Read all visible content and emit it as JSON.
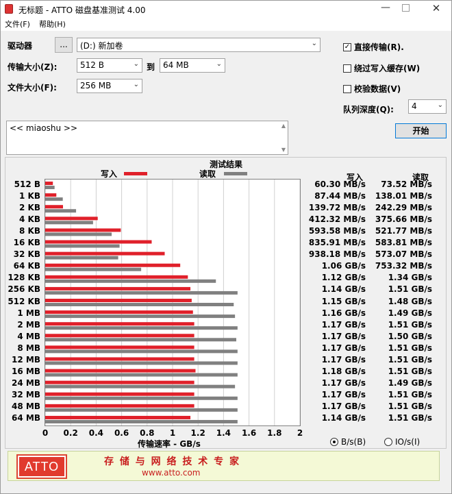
{
  "window": {
    "title": "无标题 - ATTO 磁盘基准测试 4.00",
    "controls": [
      "minimize-icon",
      "maximize-icon",
      "close-icon"
    ]
  },
  "menu": [
    {
      "label": "文件(F)"
    },
    {
      "label": "帮助(H)"
    }
  ],
  "settings": {
    "drive_label": "驱动器",
    "browse_label": "...",
    "drive_value": "(D:) 新加卷",
    "transfer_label": "传输大小(Z):",
    "transfer_from": "512 B",
    "to_label": "到",
    "transfer_to": "64 MB",
    "file_size_label": "文件大小(F):",
    "file_size": "256 MB",
    "direct_io_label": "直接传输(R).",
    "direct_io_checked": true,
    "bypass_cache_label": "绕过写入缓存(W)",
    "bypass_cache_checked": false,
    "verify_label": "校验数据(V)",
    "verify_checked": false,
    "queue_label": "队列深度(Q):",
    "queue_value": "4",
    "start_label": "开始",
    "description": "<< miaoshu >>"
  },
  "results": {
    "title": "测试结果",
    "legend_write": "写入",
    "legend_read": "读取",
    "col_write": "写入",
    "col_read": "读取",
    "write_color": "#e0202a",
    "read_color": "#808080",
    "xaxis_label": "传输速率 - GB/s",
    "unit_bytes": "B/s(B)",
    "unit_io": "IO/s(I)",
    "unit_selected": "bytes",
    "rows": [
      {
        "size": "512 B",
        "write_text": "60.30 MB/s",
        "read_text": "73.52 MB/s"
      },
      {
        "size": "1 KB",
        "write_text": "87.44 MB/s",
        "read_text": "138.01 MB/s"
      },
      {
        "size": "2 KB",
        "write_text": "139.72 MB/s",
        "read_text": "242.29 MB/s"
      },
      {
        "size": "4 KB",
        "write_text": "412.32 MB/s",
        "read_text": "375.66 MB/s"
      },
      {
        "size": "8 KB",
        "write_text": "593.58 MB/s",
        "read_text": "521.77 MB/s"
      },
      {
        "size": "16 KB",
        "write_text": "835.91 MB/s",
        "read_text": "583.81 MB/s"
      },
      {
        "size": "32 KB",
        "write_text": "938.18 MB/s",
        "read_text": "573.07 MB/s"
      },
      {
        "size": "64 KB",
        "write_text": "1.06 GB/s",
        "read_text": "753.32 MB/s"
      },
      {
        "size": "128 KB",
        "write_text": "1.12 GB/s",
        "read_text": "1.34 GB/s"
      },
      {
        "size": "256 KB",
        "write_text": "1.14 GB/s",
        "read_text": "1.51 GB/s"
      },
      {
        "size": "512 KB",
        "write_text": "1.15 GB/s",
        "read_text": "1.48 GB/s"
      },
      {
        "size": "1 MB",
        "write_text": "1.16 GB/s",
        "read_text": "1.49 GB/s"
      },
      {
        "size": "2 MB",
        "write_text": "1.17 GB/s",
        "read_text": "1.51 GB/s"
      },
      {
        "size": "4 MB",
        "write_text": "1.17 GB/s",
        "read_text": "1.50 GB/s"
      },
      {
        "size": "8 MB",
        "write_text": "1.17 GB/s",
        "read_text": "1.51 GB/s"
      },
      {
        "size": "12 MB",
        "write_text": "1.17 GB/s",
        "read_text": "1.51 GB/s"
      },
      {
        "size": "16 MB",
        "write_text": "1.18 GB/s",
        "read_text": "1.51 GB/s"
      },
      {
        "size": "24 MB",
        "write_text": "1.17 GB/s",
        "read_text": "1.49 GB/s"
      },
      {
        "size": "32 MB",
        "write_text": "1.17 GB/s",
        "read_text": "1.51 GB/s"
      },
      {
        "size": "48 MB",
        "write_text": "1.17 GB/s",
        "read_text": "1.51 GB/s"
      },
      {
        "size": "64 MB",
        "write_text": "1.14 GB/s",
        "read_text": "1.51 GB/s"
      }
    ]
  },
  "chart_data": {
    "type": "bar",
    "orientation": "horizontal",
    "title": "测试结果",
    "xlabel": "传输速率 - GB/s",
    "xlim": [
      0,
      2
    ],
    "xticks": [
      "0",
      "0.2",
      "0.4",
      "0.6",
      "0.8",
      "1",
      "1.2",
      "1.4",
      "1.6",
      "1.8",
      "2"
    ],
    "grid": true,
    "categories": [
      "512 B",
      "1 KB",
      "2 KB",
      "4 KB",
      "8 KB",
      "16 KB",
      "32 KB",
      "64 KB",
      "128 KB",
      "256 KB",
      "512 KB",
      "1 MB",
      "2 MB",
      "4 MB",
      "8 MB",
      "12 MB",
      "16 MB",
      "24 MB",
      "32 MB",
      "48 MB",
      "64 MB"
    ],
    "series": [
      {
        "name": "写入",
        "values": [
          0.0603,
          0.08744,
          0.13972,
          0.41232,
          0.59358,
          0.83591,
          0.93818,
          1.06,
          1.12,
          1.14,
          1.15,
          1.16,
          1.17,
          1.17,
          1.17,
          1.17,
          1.18,
          1.17,
          1.17,
          1.17,
          1.14
        ]
      },
      {
        "name": "读取",
        "values": [
          0.07352,
          0.13801,
          0.24229,
          0.37566,
          0.52177,
          0.58381,
          0.57307,
          0.75332,
          1.34,
          1.51,
          1.48,
          1.49,
          1.51,
          1.5,
          1.51,
          1.51,
          1.51,
          1.49,
          1.51,
          1.51,
          1.51
        ]
      }
    ]
  },
  "footer": {
    "logo_text": "ATTO",
    "slogan": "存 储 与 网 络 技 术 专 家",
    "url": "www.atto.com"
  }
}
